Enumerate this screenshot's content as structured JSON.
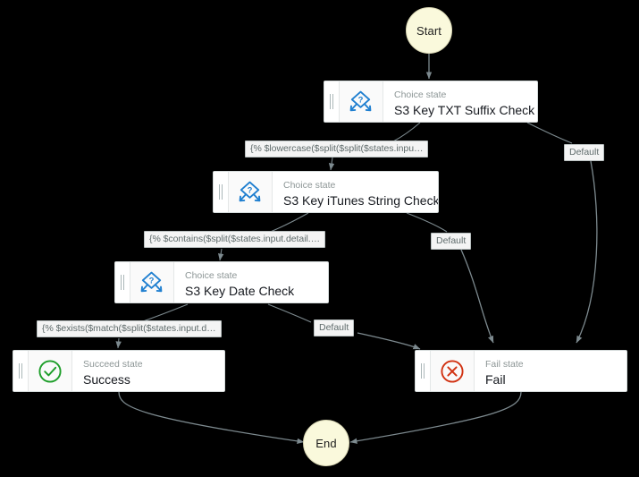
{
  "diagram": {
    "title": "AWS Step Functions state machine graph",
    "background_color": "#000000",
    "edge_color": "#7d8a8f",
    "terminal_fill": "#FAF9DC",
    "choice_icon_color": "#1f7fd0",
    "succeed_icon_color": "#1d9e29",
    "fail_icon_color": "#d13212"
  },
  "terminals": {
    "start": {
      "label": "Start",
      "name": "start-node"
    },
    "end": {
      "label": "End",
      "name": "end-node"
    }
  },
  "nodes": [
    {
      "id": "s3-key-txt-suffix-check",
      "kind": "Choice state",
      "title": "S3 Key TXT Suffix Check",
      "icon": "choice-state-icon"
    },
    {
      "id": "s3-key-itunes-string-check",
      "kind": "Choice state",
      "title": "S3 Key iTunes String Check",
      "icon": "choice-state-icon"
    },
    {
      "id": "s3-key-date-check",
      "kind": "Choice state",
      "title": "S3 Key Date Check",
      "icon": "choice-state-icon"
    },
    {
      "id": "success",
      "kind": "Succeed state",
      "title": "Success",
      "icon": "succeed-state-icon"
    },
    {
      "id": "fail",
      "kind": "Fail state",
      "title": "Fail",
      "icon": "fail-state-icon"
    }
  ],
  "edge_labels": {
    "lowercase_expr": "{% $lowercase($split($split($states.inpu…",
    "contains_expr": "{% $contains($split($states.input.detail.…",
    "exists_expr": "{% $exists($match($split($states.input.d…",
    "default_1": "Default",
    "default_2": "Default",
    "default_3": "Default"
  }
}
